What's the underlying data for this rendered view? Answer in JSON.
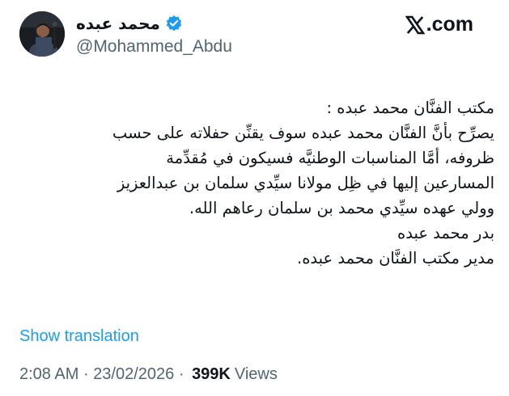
{
  "author": {
    "display_name": "محمد عبده",
    "handle": "@Mohammed_Abdu",
    "avatar_icon": "profile-photo",
    "verified_icon": "verified-badge-icon",
    "verified_color": "#1d9bf0"
  },
  "brand": {
    "logo_icon": "x-logo-icon",
    "domain_suffix": ".com"
  },
  "tweet": {
    "lines": [
      "مكتب الفنَّان محمد عبده :",
      "يصرِّح بأنَّ الفنَّان محمد عبده سوف يقنِّن حفلاته على حسب",
      "ظروفه، أمَّا المناسبات الوطنيَّه فسيكون في مُقدِّمة",
      "المسارعين إليها في ظِل مولانا سيِّدي سلمان بن عبدالعزيز",
      "وولي عهده سيِّدي محمد بن سلمان رعاهم الله.",
      "بدر محمد عبده",
      "مدير مكتب الفنَّان محمد عبده."
    ]
  },
  "actions": {
    "show_translation": "Show translation"
  },
  "meta": {
    "time": "2:08 AM",
    "separator": " · ",
    "date": "23/02/2026",
    "dot": " · ",
    "views_count": "399K",
    "views_label": "Views"
  },
  "colors": {
    "link": "#1d9bf0",
    "secondary_text": "#536471",
    "primary_text": "#0f1419"
  }
}
